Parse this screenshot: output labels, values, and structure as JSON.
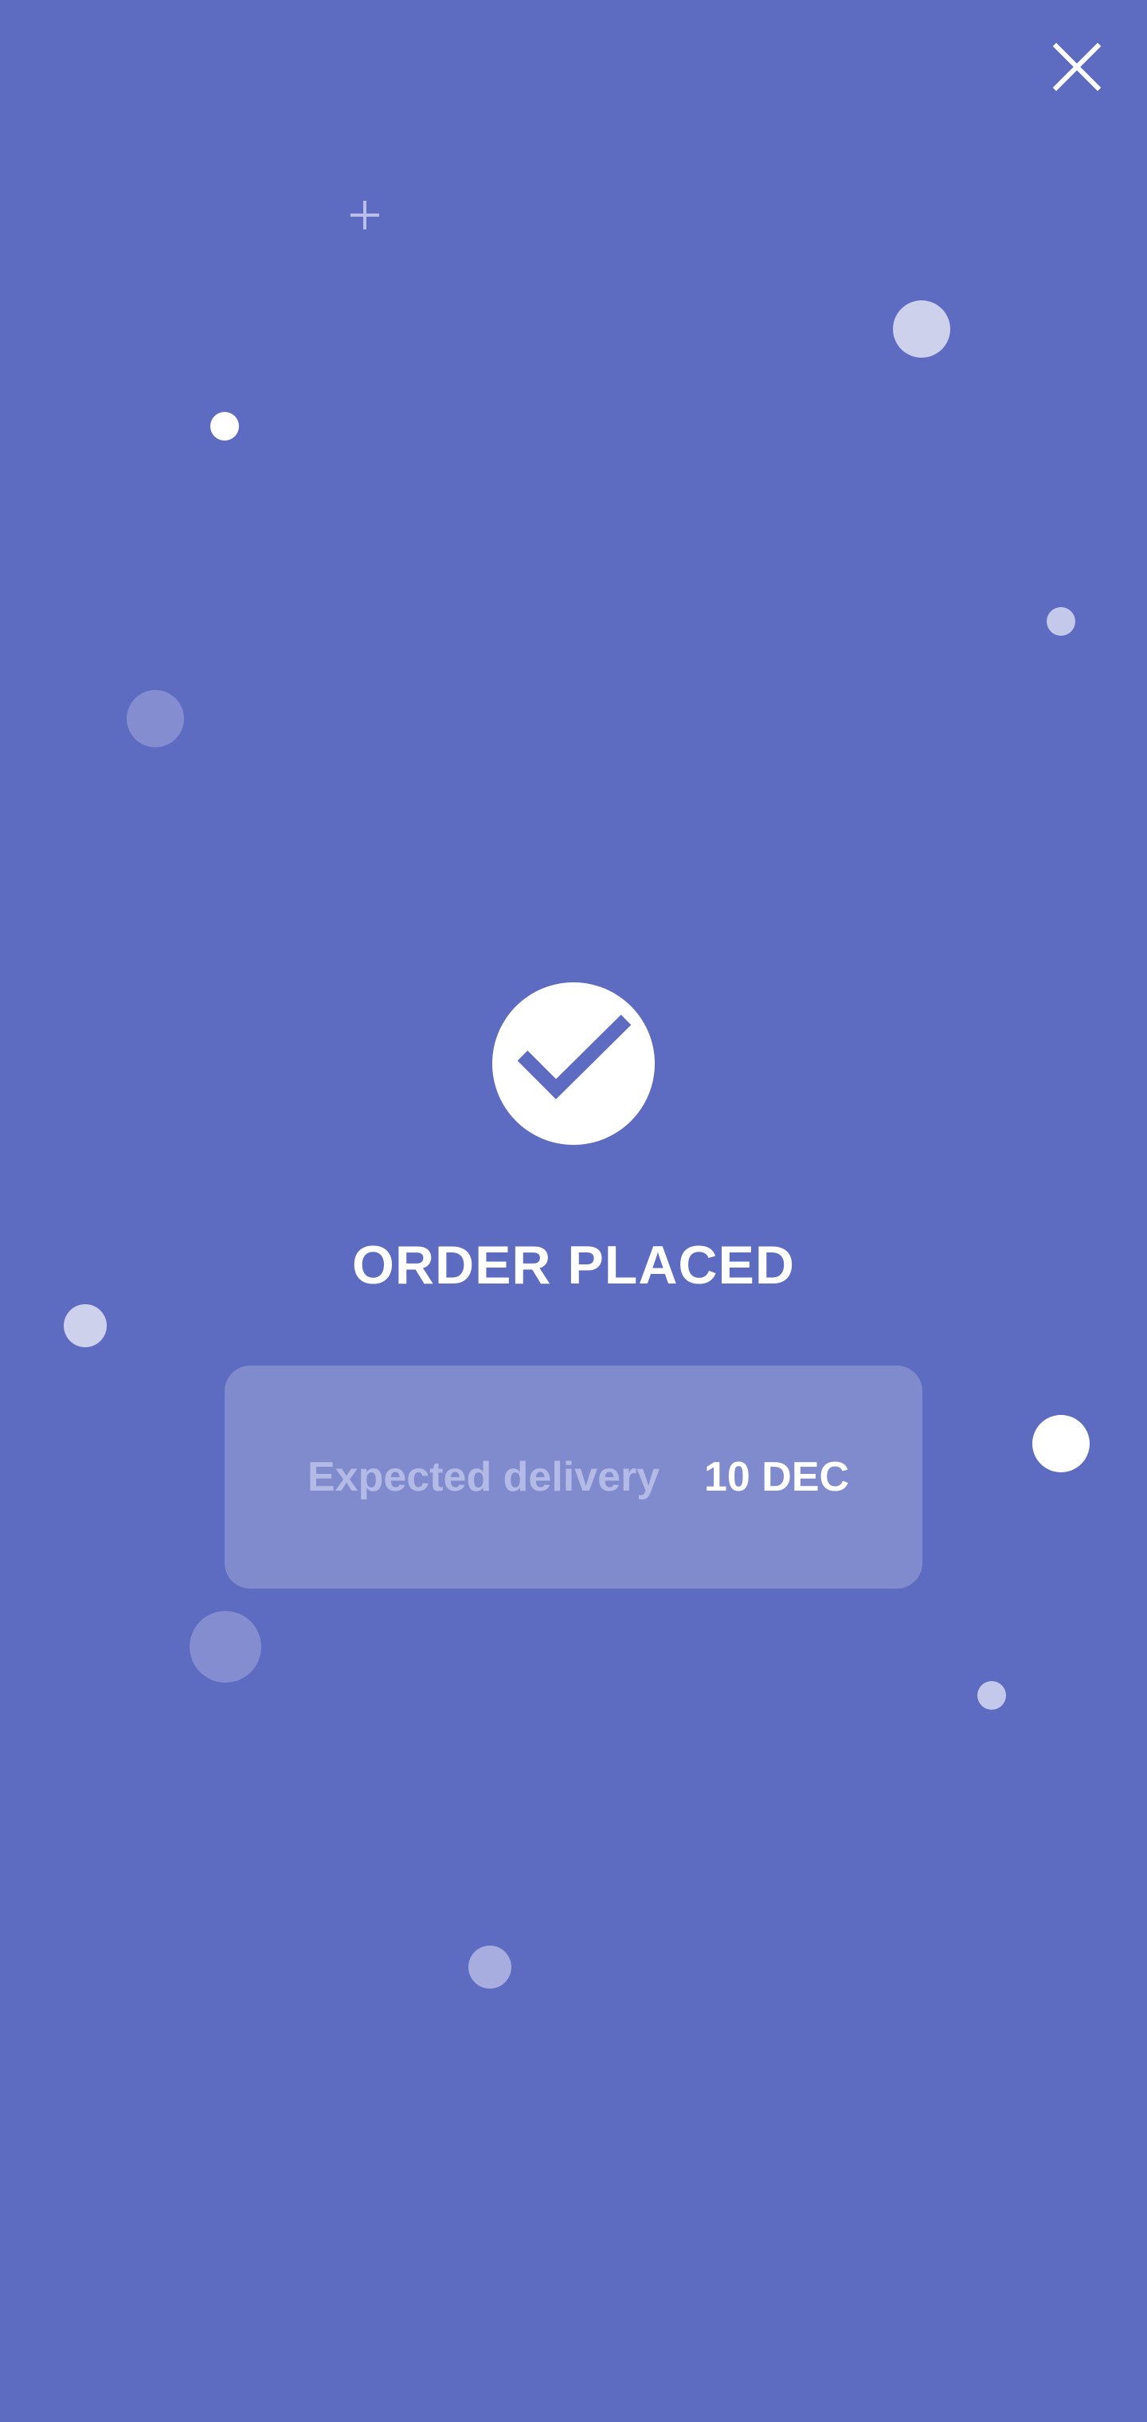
{
  "colors": {
    "background": "#5d6bc0",
    "accent": "#ffffff",
    "card": "rgba(255,255,255,0.22)",
    "label_muted": "#b4bae6"
  },
  "header": {
    "close_icon": "close-icon"
  },
  "status": {
    "icon": "check-circle-icon",
    "title": "ORDER PLACED"
  },
  "delivery": {
    "label": "Expected delivery",
    "value": "10 DEC"
  },
  "decorations": {
    "plus_icon": "plus-icon"
  }
}
